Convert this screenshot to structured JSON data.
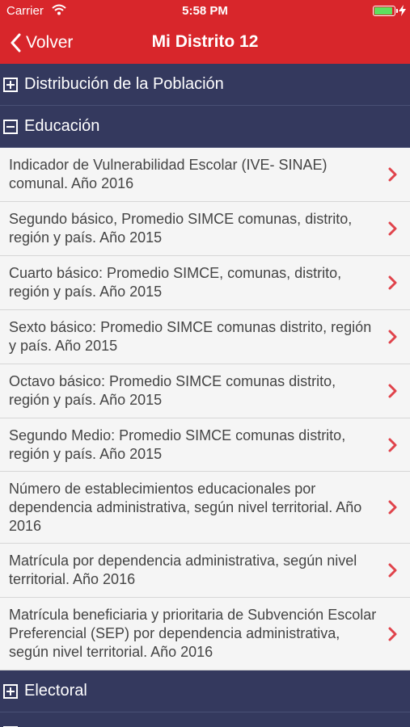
{
  "status_bar": {
    "carrier": "Carrier",
    "time": "5:58 PM"
  },
  "nav": {
    "back_label": "Volver",
    "title": "Mi Distrito 12"
  },
  "sections": [
    {
      "label": "Distribución de la Población",
      "expanded": false
    },
    {
      "label": "Educación",
      "expanded": true
    },
    {
      "label": "Electoral",
      "expanded": false
    }
  ],
  "education_items": [
    {
      "text": "Indicador de Vulnerabilidad Escolar (IVE- SINAE) comunal. Año 2016"
    },
    {
      "text": "Segundo básico, Promedio SIMCE comunas, distrito, región y país. Año 2015"
    },
    {
      "text": "Cuarto básico: Promedio SIMCE, comunas, distrito, región y país. Año 2015"
    },
    {
      "text": "Sexto básico: Promedio SIMCE comunas distrito, región y país. Año 2015"
    },
    {
      "text": "Octavo básico: Promedio SIMCE comunas distrito, región y país. Año 2015"
    },
    {
      "text": "Segundo Medio: Promedio SIMCE comunas distrito, región y país. Año 2015"
    },
    {
      "text": "Número de establecimientos educacionales por dependencia administrativa, según nivel territorial. Año 2016"
    },
    {
      "text": "Matrícula por dependencia administrativa, según nivel territorial. Año 2016"
    },
    {
      "text": "Matrícula beneficiaria y prioritaria de Subvención Escolar Preferencial (SEP) por dependencia administrativa, según nivel territorial. Año 2016"
    }
  ],
  "colors": {
    "nav_bar": "#d8262b",
    "section_header": "#34395e",
    "chevron": "#e0434b",
    "battery": "#5ee05e"
  }
}
